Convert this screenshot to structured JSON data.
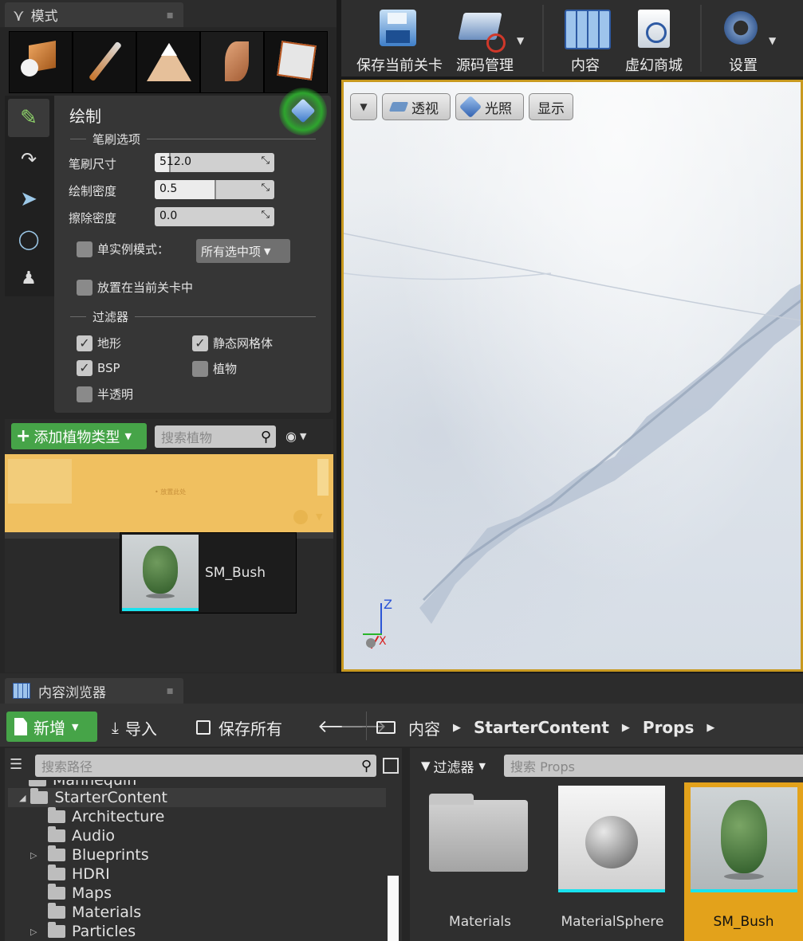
{
  "modes_panel": {
    "tab_title": "模式",
    "paint": {
      "title": "绘制",
      "brush_section": "笔刷选项",
      "fields": [
        {
          "label": "笔刷尺寸",
          "value": "512.0",
          "fill": 0.12
        },
        {
          "label": "绘制密度",
          "value": "0.5",
          "fill": 0.5
        },
        {
          "label": "擦除密度",
          "value": "0.0",
          "fill": 0.0
        }
      ],
      "single_instance_label": "单实例模式：",
      "single_instance_value": "所有选中项",
      "place_in_level_label": "放置在当前关卡中",
      "filter_section": "过滤器",
      "filters": [
        {
          "label": "地形",
          "checked": true
        },
        {
          "label": "静态网格体",
          "checked": true
        },
        {
          "label": "BSP",
          "checked": true
        },
        {
          "label": "植物",
          "checked": false
        },
        {
          "label": "半透明",
          "checked": false
        }
      ]
    },
    "foliage": {
      "add_button": "添加植物类型",
      "search_placeholder": "搜索植物",
      "drop_hint": "• 放置此处",
      "drag_item": "SM_Bush"
    }
  },
  "toolbar": {
    "buttons": [
      "保存当前关卡",
      "源码管理",
      "内容",
      "虚幻商城",
      "设置"
    ]
  },
  "viewport": {
    "buttons": [
      "透视",
      "光照",
      "显示"
    ],
    "axis_z": "Z",
    "axis_x": "X"
  },
  "content_browser": {
    "tab_title": "内容浏览器",
    "new_button": "新增",
    "import_button": "导入",
    "save_all_button": "保存所有",
    "breadcrumb": [
      "内容",
      "StarterContent",
      "Props"
    ],
    "path_search_placeholder": "搜索路径",
    "filter_label": "过滤器",
    "asset_search_placeholder": "搜索 Props",
    "tree": {
      "partial_item": "Mannequin",
      "root": "StarterContent",
      "children": [
        {
          "label": "Architecture",
          "expandable": false
        },
        {
          "label": "Audio",
          "expandable": false
        },
        {
          "label": "Blueprints",
          "expandable": true
        },
        {
          "label": "HDRI",
          "expandable": false
        },
        {
          "label": "Maps",
          "expandable": false
        },
        {
          "label": "Materials",
          "expandable": false
        },
        {
          "label": "Particles",
          "expandable": true
        }
      ]
    },
    "assets": [
      "Materials",
      "MaterialSphere",
      "SM_Bush"
    ]
  },
  "colors": {
    "accent_green": "#4caf50",
    "selection_orange": "#e3a21b",
    "drop_yellow": "#f0c060",
    "cyan_bar": "#19e2ee"
  }
}
